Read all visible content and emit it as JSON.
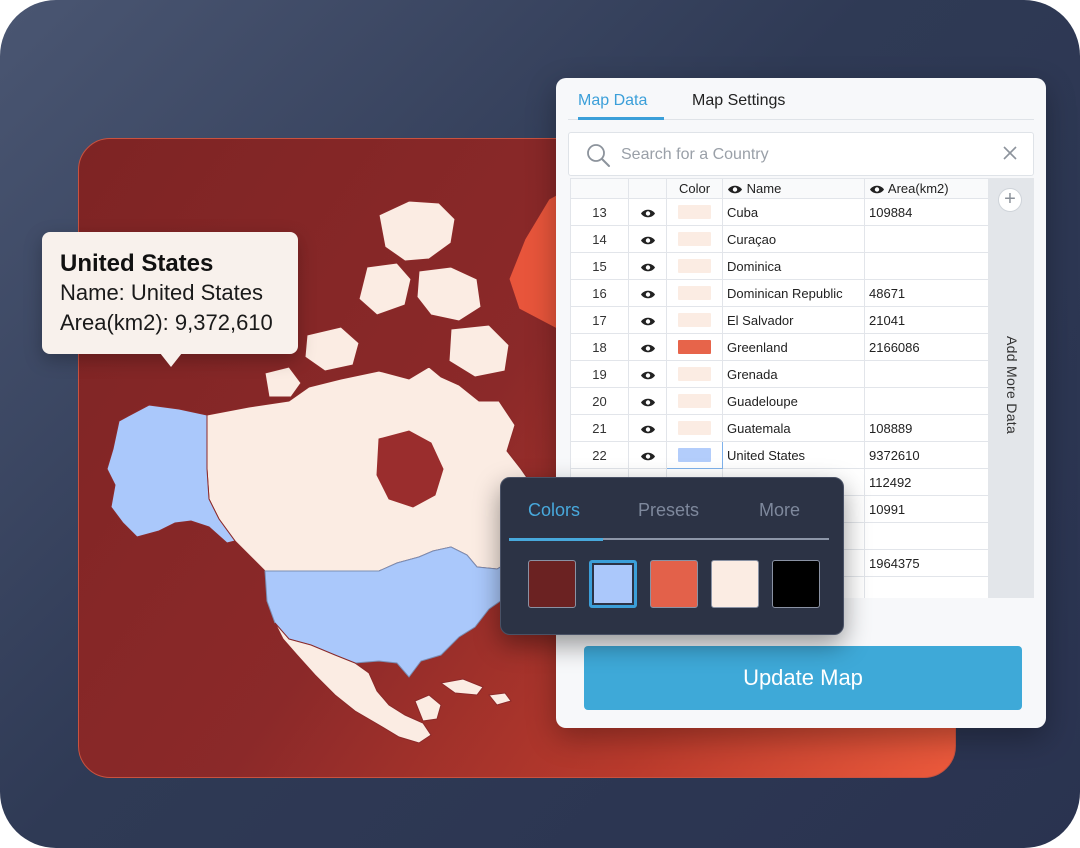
{
  "tooltip": {
    "title": "United States",
    "name_line": "Name: United States",
    "area_line": "Area(km2): 9,372,610"
  },
  "panel": {
    "tabs": [
      {
        "label": "Map Data",
        "active": true
      },
      {
        "label": "Map Settings",
        "active": false
      }
    ],
    "search": {
      "placeholder": "Search for a Country",
      "value": ""
    },
    "table": {
      "headers": {
        "color": "Color",
        "name": "Name",
        "area": "Area(km2)"
      },
      "rows": [
        {
          "num": "13",
          "color": "#fbece3",
          "name": "Cuba",
          "area": "109884"
        },
        {
          "num": "14",
          "color": "#fbece3",
          "name": "Curaçao",
          "area": ""
        },
        {
          "num": "15",
          "color": "#fbece3",
          "name": "Dominica",
          "area": ""
        },
        {
          "num": "16",
          "color": "#fbece3",
          "name": "Dominican Republic",
          "area": "48671"
        },
        {
          "num": "17",
          "color": "#fbece3",
          "name": "El Salvador",
          "area": "21041"
        },
        {
          "num": "18",
          "color": "#e7644a",
          "name": "Greenland",
          "area": "2166086"
        },
        {
          "num": "19",
          "color": "#fbece3",
          "name": "Grenada",
          "area": ""
        },
        {
          "num": "20",
          "color": "#fbece3",
          "name": "Guadeloupe",
          "area": ""
        },
        {
          "num": "21",
          "color": "#fbece3",
          "name": "Guatemala",
          "area": "108889"
        },
        {
          "num": "22",
          "color": "#b3cdfb",
          "name": "United States",
          "area": "9372610",
          "selected": true
        },
        {
          "num": "",
          "color": "",
          "name": "",
          "area": "112492"
        },
        {
          "num": "",
          "color": "",
          "name": "",
          "area": "10991"
        },
        {
          "num": "",
          "color": "",
          "name": "",
          "area": ""
        },
        {
          "num": "",
          "color": "",
          "name": "",
          "area": "1964375"
        },
        {
          "num": "",
          "color": "",
          "name": "",
          "area": ""
        }
      ]
    },
    "side_strip_label": "Add More Data",
    "update_button": "Update Map"
  },
  "picker": {
    "tabs": [
      {
        "label": "Colors",
        "active": true
      },
      {
        "label": "Presets",
        "active": false
      },
      {
        "label": "More",
        "active": false
      }
    ],
    "swatches": [
      {
        "color": "#6b2222",
        "selected": false
      },
      {
        "color": "#abc8fb",
        "selected": true
      },
      {
        "color": "#e3614a",
        "selected": false
      },
      {
        "color": "#fbece3",
        "selected": false
      },
      {
        "color": "#000000",
        "selected": false
      }
    ]
  },
  "map_colors": {
    "background": "#8b2929",
    "canada": "#fbece3",
    "united_states": "#aac8fb",
    "greenland": "#e8553b",
    "mexico": "#fbece3",
    "water": "#9a2d2d"
  },
  "icons": {
    "search": "search-icon",
    "close": "close-icon",
    "eye": "eye-icon",
    "plus": "plus-icon"
  }
}
